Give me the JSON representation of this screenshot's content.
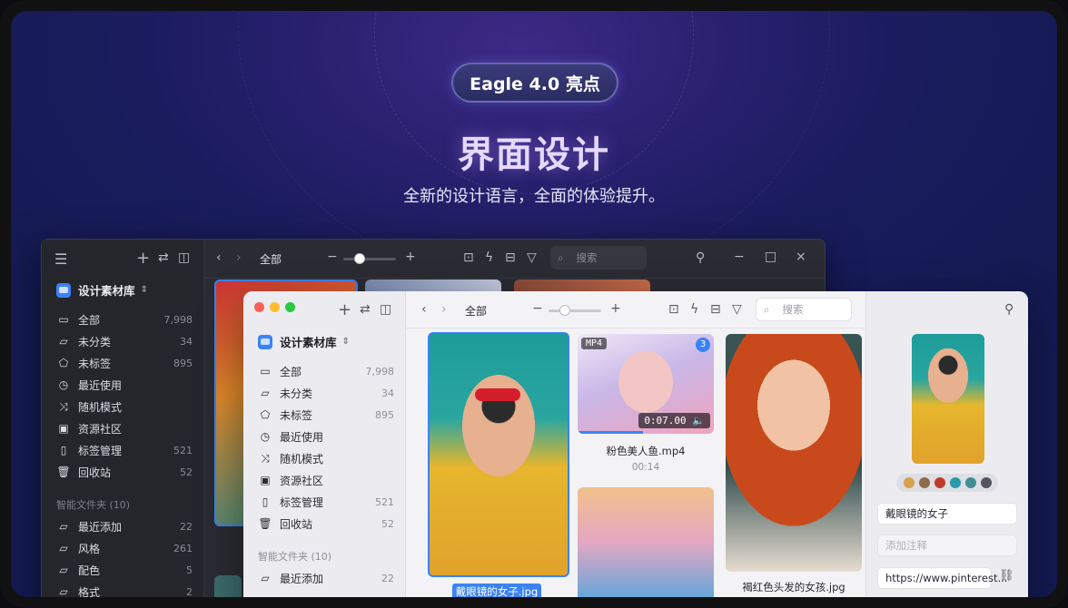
{
  "hero": {
    "badge": "Eagle 4.0 亮点",
    "title": "界面设计",
    "subtitle": "全新的设计语言，全面的体验提升。"
  },
  "library": {
    "name": "设计素材库"
  },
  "toolbar": {
    "breadcrumb": "全部",
    "search_placeholder": "搜索"
  },
  "sidebar": {
    "items": [
      {
        "icon": "inbox-icon",
        "label": "全部",
        "count": "7,998"
      },
      {
        "icon": "folder-uncategorized-icon",
        "label": "未分类",
        "count": "34"
      },
      {
        "icon": "tag-untagged-icon",
        "label": "未标签",
        "count": "895"
      },
      {
        "icon": "clock-icon",
        "label": "最近使用",
        "count": ""
      },
      {
        "icon": "shuffle-icon",
        "label": "随机模式",
        "count": ""
      },
      {
        "icon": "community-icon",
        "label": "资源社区",
        "count": ""
      },
      {
        "icon": "bookmark-icon",
        "label": "标签管理",
        "count": "521"
      },
      {
        "icon": "trash-icon",
        "label": "回收站",
        "count": "52"
      }
    ],
    "smart_folders_header": "智能文件夹 (10)",
    "smart_folders": [
      {
        "label": "最近添加",
        "count": "22"
      },
      {
        "label": "风格",
        "count": "261"
      },
      {
        "label": "配色",
        "count": "5"
      },
      {
        "label": "格式",
        "count": "2"
      }
    ]
  },
  "grid": {
    "items": [
      {
        "caption": "戴眼镜的女子.jpg",
        "selected": true
      },
      {
        "caption": "粉色美人鱼.mp4",
        "subcaption": "00:14",
        "badge": "MP4",
        "count_badge": "3",
        "timecode": "0:07.00"
      },
      {
        "caption": "褐红色头发的女孩.jpg"
      },
      {
        "caption": ""
      }
    ]
  },
  "inspector": {
    "title_value": "戴眼镜的女子",
    "note_placeholder": "添加注释",
    "url_value": "https://www.pinterest...",
    "palette": [
      "#d6a24a",
      "#8d6a4a",
      "#c0392b",
      "#2b9aa8",
      "#3f8f93",
      "#555560"
    ]
  },
  "colors": {
    "accent": "#3b82f6",
    "selection": "#3b82f6"
  }
}
